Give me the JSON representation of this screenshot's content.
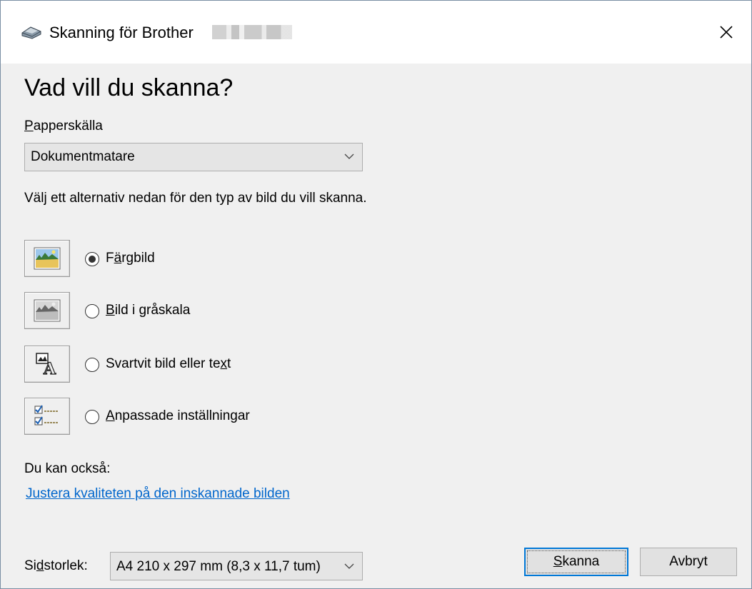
{
  "window": {
    "title": "Skanning för Brother"
  },
  "main": {
    "heading": "Vad vill du skanna?",
    "paper_source": {
      "label_mnemonic": "P",
      "label_rest": "apperskälla",
      "value": "Dokumentmatare"
    },
    "description": "Välj ett alternativ nedan för den typ av bild du vill skanna.",
    "options": [
      {
        "pre": "F",
        "mn": "ä",
        "post": "rgbild",
        "selected": true,
        "icon": "color-photo-icon"
      },
      {
        "pre": "",
        "mn": "B",
        "post": "ild i gråskala",
        "selected": false,
        "icon": "grayscale-photo-icon"
      },
      {
        "pre": "Svartvit bild eller te",
        "mn": "x",
        "post": "t",
        "selected": false,
        "icon": "black-white-text-icon"
      },
      {
        "pre": "",
        "mn": "A",
        "post": "npassade inställningar",
        "selected": false,
        "icon": "custom-settings-icon"
      }
    ],
    "also_label": "Du kan också:",
    "adjust_link": "Justera kvaliteten på den inskannade bilden"
  },
  "footer": {
    "size_label_pre": "Si",
    "size_label_mn": "d",
    "size_label_post": "storlek:",
    "size_value": "A4 210 x 297 mm (8,3 x 11,7 tum)",
    "scan_mn": "S",
    "scan_rest": "kanna",
    "cancel_label": "Avbryt"
  },
  "colors": {
    "link": "#0066cc",
    "primary_border": "#0078d7",
    "background": "#f0f0f0"
  }
}
